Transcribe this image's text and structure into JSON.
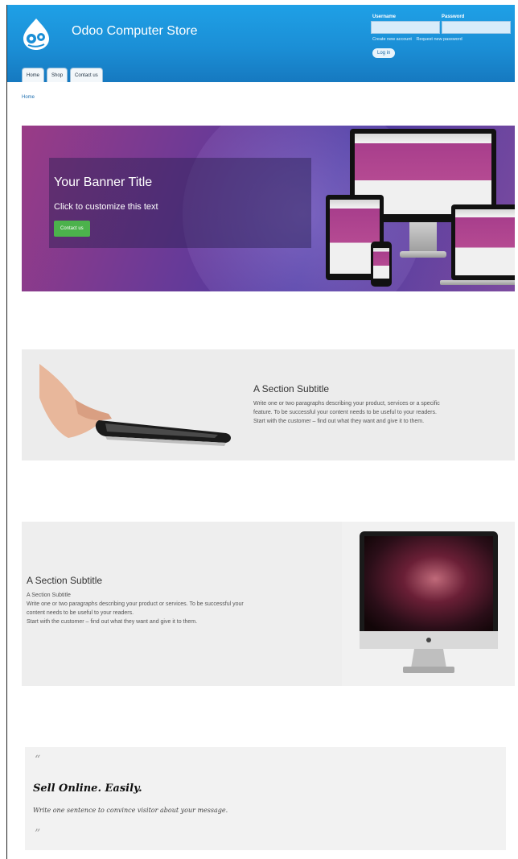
{
  "header": {
    "site_title": "Odoo Computer Store",
    "logo_icon": "odoo-drop-icon",
    "login": {
      "username_label": "Username",
      "password_label": "Password",
      "create_account": "Create new account",
      "request_password": "Request new password",
      "login_button": "Log in"
    },
    "tabs": [
      {
        "label": "Home"
      },
      {
        "label": "Shop"
      },
      {
        "label": "Contact us"
      }
    ],
    "accent_color": "#1b8fd6"
  },
  "breadcrumb": {
    "home": "Home"
  },
  "banner": {
    "title": "Your Banner Title",
    "text": "Click to customize this text",
    "button": "Contact us",
    "button_color": "#4cb24c"
  },
  "section1": {
    "subtitle": "A Section Subtitle",
    "paragraph_lines": [
      "Write one or two paragraphs describing your product, services or a specific",
      "feature. To be successful your content needs to be useful to your readers.",
      "Start with the customer – find out what they want and give it to them."
    ]
  },
  "section2": {
    "subtitle": "A Section Subtitle",
    "small_subtitle": "A Section Subtitle",
    "paragraph_lines": [
      "Write one or two paragraphs describing your product or services. To be successful your",
      "content needs to be useful to your readers.",
      "Start with the customer – find out what they want and give it to them."
    ]
  },
  "quote": {
    "open_mark": "“",
    "title": "Sell Online. Easily.",
    "subtitle": "Write one sentence to convince visitor about your message.",
    "close_mark": "”"
  }
}
